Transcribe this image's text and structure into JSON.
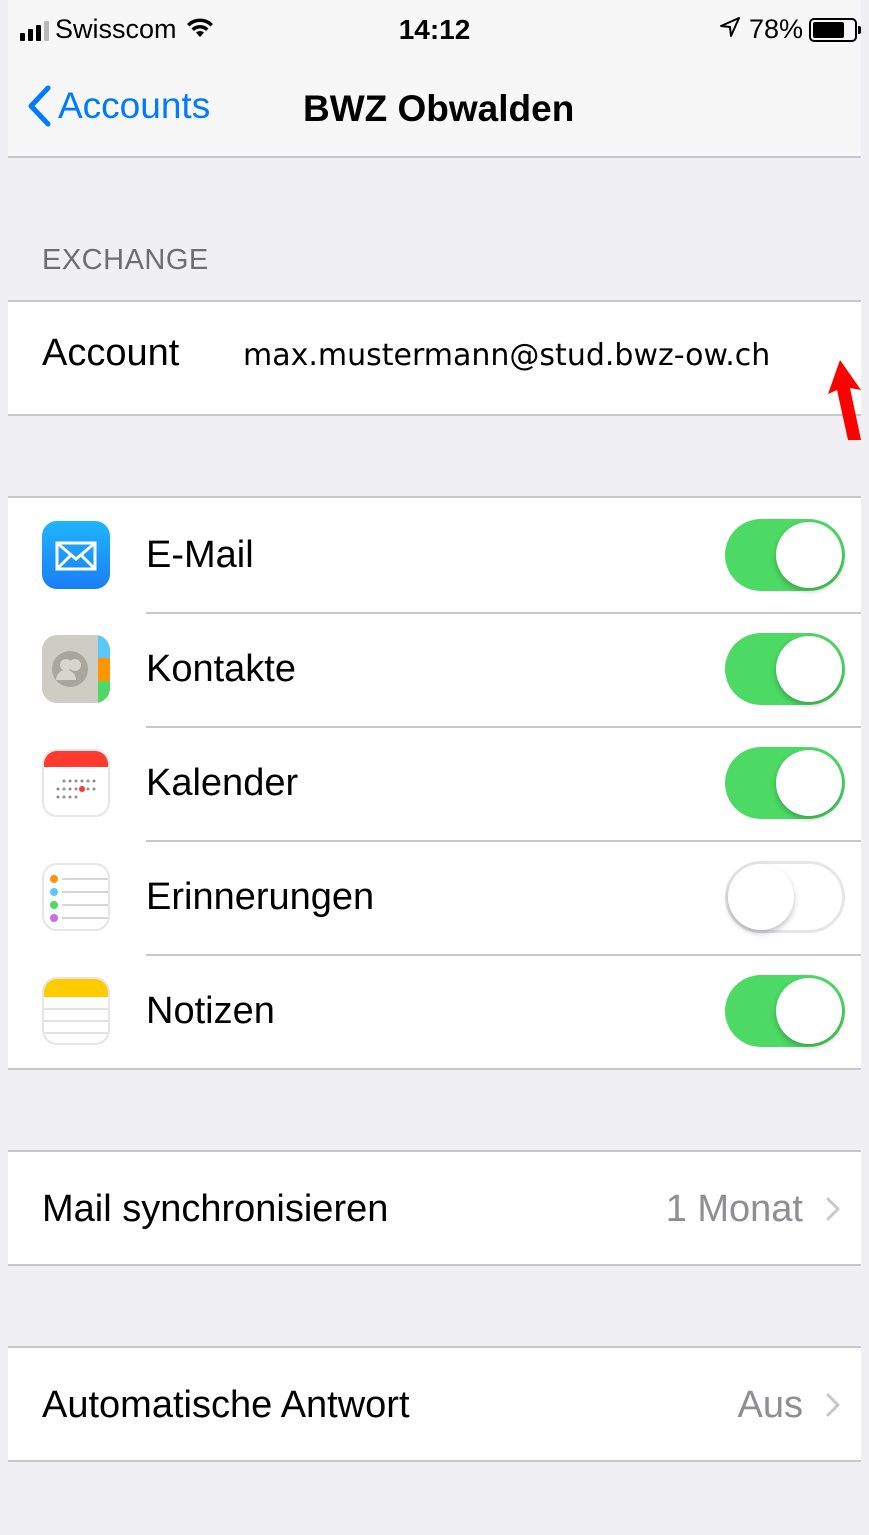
{
  "status_bar": {
    "carrier": "Swisscom",
    "time": "14:12",
    "battery": "78%",
    "battery_level": 0.78
  },
  "nav": {
    "back_label": "Accounts",
    "title": "BWZ Obwalden"
  },
  "section_header": "EXCHANGE",
  "account": {
    "label": "Account",
    "value": "max.mustermann@stud.bwz-ow.ch"
  },
  "services": [
    {
      "label": "E-Mail",
      "icon": "mail-icon",
      "enabled": true
    },
    {
      "label": "Kontakte",
      "icon": "contacts-icon",
      "enabled": true
    },
    {
      "label": "Kalender",
      "icon": "calendar-icon",
      "enabled": true
    },
    {
      "label": "Erinnerungen",
      "icon": "reminders-icon",
      "enabled": false
    },
    {
      "label": "Notizen",
      "icon": "notes-icon",
      "enabled": true
    }
  ],
  "mail_sync": {
    "label": "Mail synchronisieren",
    "value": "1 Monat"
  },
  "auto_reply": {
    "label": "Automatische Antwort",
    "value": "Aus"
  },
  "colors": {
    "accent": "#007aff",
    "toggle_on": "#4cd964",
    "background": "#efeff4",
    "annotation_arrow": "#ff0000"
  }
}
